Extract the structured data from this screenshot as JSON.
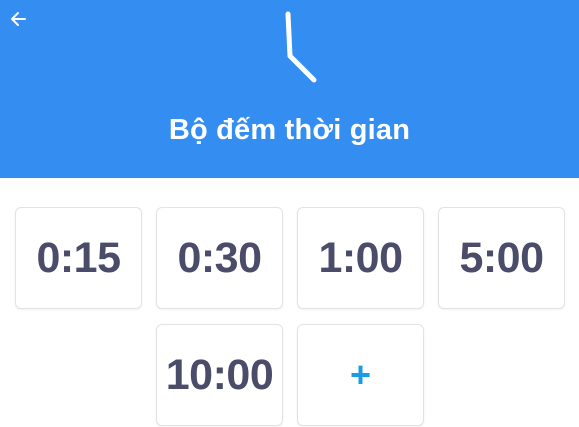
{
  "header": {
    "title": "Bộ đếm thời gian",
    "background": "#348ef1",
    "back_icon": "arrow-left-icon",
    "clock_icon": "clock-hands-icon"
  },
  "presets": [
    {
      "label": "0:15"
    },
    {
      "label": "0:30"
    },
    {
      "label": "1:00"
    },
    {
      "label": "5:00"
    },
    {
      "label": "10:00"
    }
  ],
  "add_button": {
    "label": "+",
    "color": "#1a9be3"
  }
}
